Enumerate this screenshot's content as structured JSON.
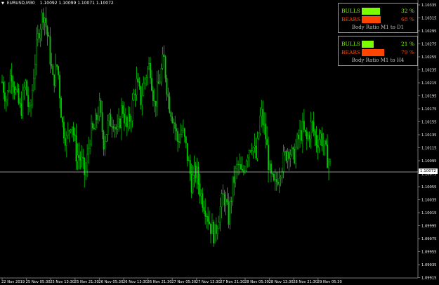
{
  "header": {
    "symbol": "EURUSD,M30",
    "ohlc": "1.10092 1.10099 1.10071 1.10072"
  },
  "panels": [
    {
      "bulls_label": "BULLS",
      "bulls_pct": 32,
      "bulls_text": "32 %",
      "bears_label": "BEARS",
      "bears_pct": 68,
      "bears_text": "68 %",
      "caption": "Body Ratio M1 to D1"
    },
    {
      "bulls_label": "BULLS",
      "bulls_pct": 21,
      "bulls_text": "21 %",
      "bears_label": "BEARS",
      "bears_pct": 79,
      "bears_text": "79 %",
      "caption": "Body Ratio M1 to H4"
    }
  ],
  "current_price": "1.10072",
  "colors": {
    "bull": "#7cfc00",
    "bear": "#ff4500",
    "candle": "#00cc00",
    "grid_line": "#c0c0c0"
  },
  "chart_data": {
    "type": "candlestick",
    "price_ticks": [
      "1.10335",
      "1.10315",
      "1.10295",
      "1.10275",
      "1.10255",
      "1.10235",
      "1.10215",
      "1.10195",
      "1.10175",
      "1.10155",
      "1.10135",
      "1.10115",
      "1.10095",
      "1.10075",
      "1.10055",
      "1.10035",
      "1.10015",
      "1.09995",
      "1.09975",
      "1.09955",
      "1.09935",
      "1.09915"
    ],
    "time_ticks": [
      "22 Nov 2019",
      "25 Nov 05:30",
      "25 Nov 13:30",
      "25 Nov 21:30",
      "26 Nov 05:30",
      "26 Nov 13:30",
      "26 Nov 21:30",
      "27 Nov 05:30",
      "27 Nov 13:30",
      "27 Nov 21:30",
      "28 Nov 05:30",
      "28 Nov 13:30",
      "28 Nov 21:30",
      "29 Nov 05:30"
    ],
    "ylim": [
      1.0991,
      1.1034
    ],
    "close_path": [
      1.1021,
      1.1018,
      1.1023,
      1.1019,
      1.1016,
      1.1021,
      1.1015,
      1.1024,
      1.103,
      1.1033,
      1.1028,
      1.1021,
      1.1024,
      1.1014,
      1.1011,
      1.1015,
      1.1009,
      1.1008,
      1.1005,
      1.1012,
      1.1013,
      1.1017,
      1.1011,
      1.1014,
      1.1015,
      1.1012,
      1.1017,
      1.1013,
      1.1016,
      1.1021,
      1.1018,
      1.1022,
      1.1024,
      1.1017,
      1.1021,
      1.1025,
      1.1018,
      1.1015,
      1.1011,
      1.1013,
      1.1009,
      1.1004,
      1.1006,
      1.1002,
      1.1,
      1.0997,
      1.0995,
      1.0999,
      1.1002,
      1.0998,
      1.1004,
      1.1007,
      1.1005,
      1.1009,
      1.1011,
      1.1008,
      1.1016,
      1.1012,
      1.1005,
      1.1003,
      1.1006,
      1.1008,
      1.101,
      1.1008,
      1.1011,
      1.1013,
      1.1011,
      1.1014,
      1.1011,
      1.1012,
      1.1009,
      1.1007
    ]
  }
}
